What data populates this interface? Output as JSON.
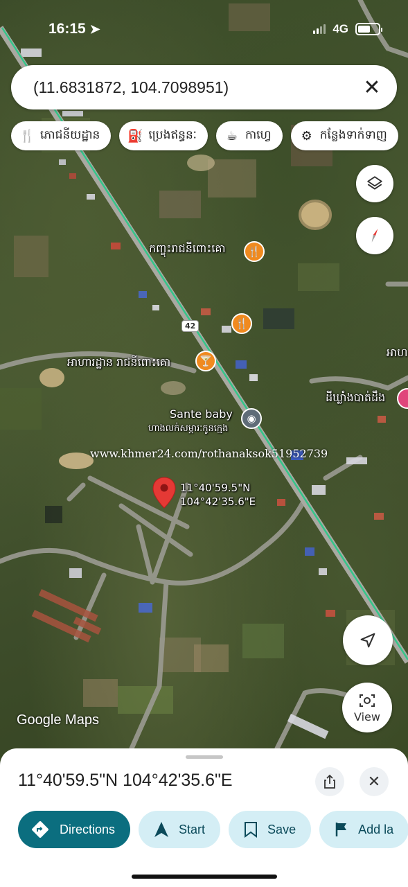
{
  "status_bar": {
    "time": "16:15",
    "network": "4G"
  },
  "search": {
    "query": "(11.6831872, 104.7098951)"
  },
  "chips": [
    {
      "icon": "restaurant-icon",
      "label": "ភោជនីយដ្ឋាន"
    },
    {
      "icon": "gas-station-icon",
      "label": "ប្រេងឥន្ធនៈ"
    },
    {
      "icon": "coffee-icon",
      "label": "កាហ្វេ"
    },
    {
      "icon": "attraction-icon",
      "label": "កន្លែងទាក់ទាញ"
    }
  ],
  "map": {
    "labels": {
      "restaurant_1": "កញ្ចុះរាជនីពោះគោ",
      "restaurant_2": "អាហារដ្ឋាន រាជនីពោះគោ",
      "shop_name": "Sante baby",
      "shop_subtitle": "ហាងលក់សម្ភារៈកូនក្មេង",
      "right_place": "ដីឃ្លាំងបាត់ដឹង",
      "right_edge": "អាហ",
      "road_number": "42",
      "pin_lat": "11°40'59.5\"N",
      "pin_lng": "104°42'35.6\"E"
    },
    "watermark": "www.khmer24.com/rothanaksok51952739",
    "logo": "Google Maps",
    "view_button": "View"
  },
  "sheet": {
    "coordinates": "11°40'59.5\"N 104°42'35.6\"E",
    "actions": {
      "directions": "Directions",
      "start": "Start",
      "save": "Save",
      "add_label": "Add la"
    }
  },
  "colors": {
    "primary": "#0b6e7f",
    "secondary_bg": "#d4eef5",
    "pin": "#e53935",
    "poi": "#f08a1f"
  }
}
